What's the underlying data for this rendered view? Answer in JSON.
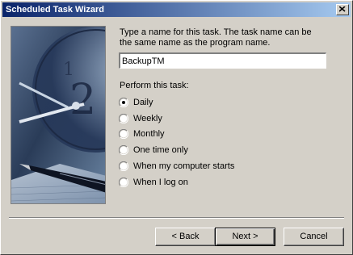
{
  "window": {
    "title": "Scheduled Task Wizard"
  },
  "prompt": {
    "line1": "Type a name for this task.  The task name can be",
    "line2": "the same name as the program name."
  },
  "task_name": {
    "value": "BackupTM"
  },
  "perform": {
    "label": "Perform this task:",
    "options": [
      {
        "label": "Daily",
        "selected": true
      },
      {
        "label": "Weekly",
        "selected": false
      },
      {
        "label": "Monthly",
        "selected": false
      },
      {
        "label": "One time only",
        "selected": false
      },
      {
        "label": "When my computer starts",
        "selected": false
      },
      {
        "label": "When I log on",
        "selected": false
      }
    ]
  },
  "buttons": {
    "back": "< Back",
    "next": "Next >",
    "cancel": "Cancel"
  },
  "colors": {
    "titlebar_start": "#0a246a",
    "titlebar_end": "#a6caf0",
    "face": "#d4d0c8"
  }
}
